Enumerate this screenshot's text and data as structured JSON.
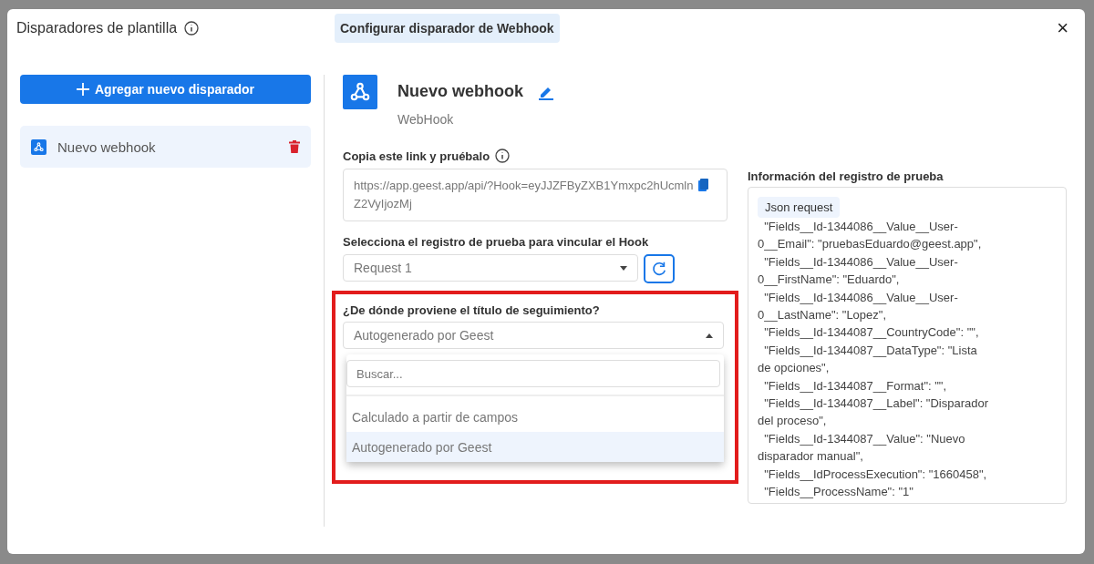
{
  "dialog": {
    "title": "Disparadores de plantilla",
    "tab": "Configurar disparador de Webhook",
    "close": "×"
  },
  "sidebar": {
    "add_button": "Agregar nuevo disparador",
    "items": [
      {
        "label": "Nuevo webhook",
        "selected": true
      }
    ]
  },
  "webhook": {
    "name": "Nuevo webhook",
    "type": "WebHook"
  },
  "link": {
    "label": "Copia este link y pruébalo",
    "value": "https://app.geest.app/api/?Hook=eyJJZFByZXB1Ymxpc2hUcmlnZ2VyIjozMj"
  },
  "test_record": {
    "label": "Selecciona el registro de prueba para vincular el Hook",
    "value": "Request 1"
  },
  "title_source": {
    "label": "¿De dónde proviene el título de seguimiento?",
    "value": "Autogenerado por Geest",
    "expanded": true,
    "search_placeholder": "Buscar...",
    "options": [
      {
        "label": "Calculado a partir de campos",
        "selected": false
      },
      {
        "label": "Autogenerado por Geest",
        "selected": true
      }
    ]
  },
  "record_info": {
    "label": "Información del registro de prueba",
    "tag": "Json request",
    "lines": [
      "  \"Fields__Id-1344086__Value__User-",
      "0__Email\": \"pruebasEduardo@geest.app\",",
      "  \"Fields__Id-1344086__Value__User-",
      "0__FirstName\": \"Eduardo\",",
      "  \"Fields__Id-1344086__Value__User-",
      "0__LastName\": \"Lopez\",",
      "  \"Fields__Id-1344087__CountryCode\": \"\",",
      "  \"Fields__Id-1344087__DataType\": \"Lista",
      "de opciones\",",
      "  \"Fields__Id-1344087__Format\": \"\",",
      "  \"Fields__Id-1344087__Label\": \"Disparador",
      "del proceso\",",
      "  \"Fields__Id-1344087__Value\": \"Nuevo",
      "disparador manual\",",
      "  \"Fields__IdProcessExecution\": \"1660458\",",
      "  \"Fields__ProcessName\": \"1\""
    ]
  }
}
